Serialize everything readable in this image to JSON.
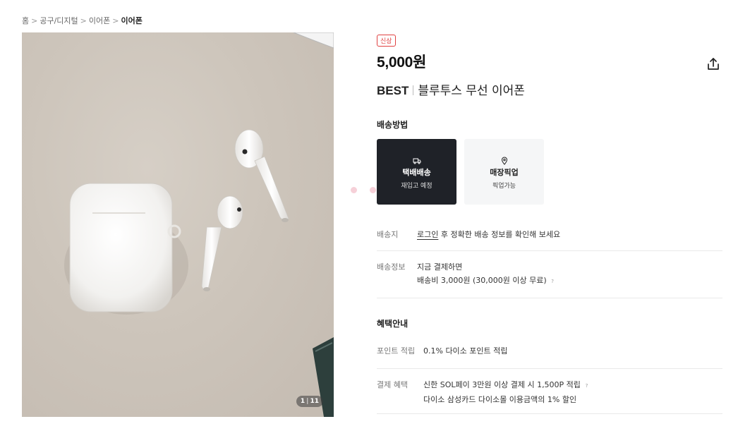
{
  "breadcrumb": [
    "홈",
    "공구/디지털",
    "이어폰",
    "이어폰"
  ],
  "breadcrumb_sep": ">",
  "gallery": {
    "current": "1",
    "total": "11"
  },
  "product": {
    "badge": "신상",
    "price": "5,000원",
    "brand": "BEST",
    "name": "블루투스 무선 이어폰"
  },
  "shipping": {
    "heading": "배송방법",
    "options": [
      {
        "name": "택배배송",
        "sub": "재입고 예정",
        "icon": "truck-icon",
        "selected": true
      },
      {
        "name": "매장픽업",
        "sub": "픽업가능",
        "icon": "location-pin-icon",
        "selected": false
      }
    ],
    "address_label": "배송지",
    "login_link": "로그인",
    "address_text": " 후 정확한 배송 정보를 확인해 보세요",
    "info_label": "배송정보",
    "info_line1": "지금 결제하면",
    "info_line2": "배송비 3,000원 (30,000원 이상 무료)",
    "help": "?"
  },
  "benefits": {
    "heading": "혜택안내",
    "points_label": "포인트 적립",
    "points_value": "0.1% 다이소 포인트 적립",
    "payment_label": "결제 혜택",
    "payment_line1": "신한 SOL페이 3만원 이상 결제 시 1,500P 적립",
    "payment_line2": "다이소 삼성카드 다이소몰 이용금액의 1% 할인",
    "help": "?"
  },
  "colors": {
    "badge": "#e04040",
    "selected_bg": "#1f2228",
    "dot_active": "#f0a0b2"
  }
}
